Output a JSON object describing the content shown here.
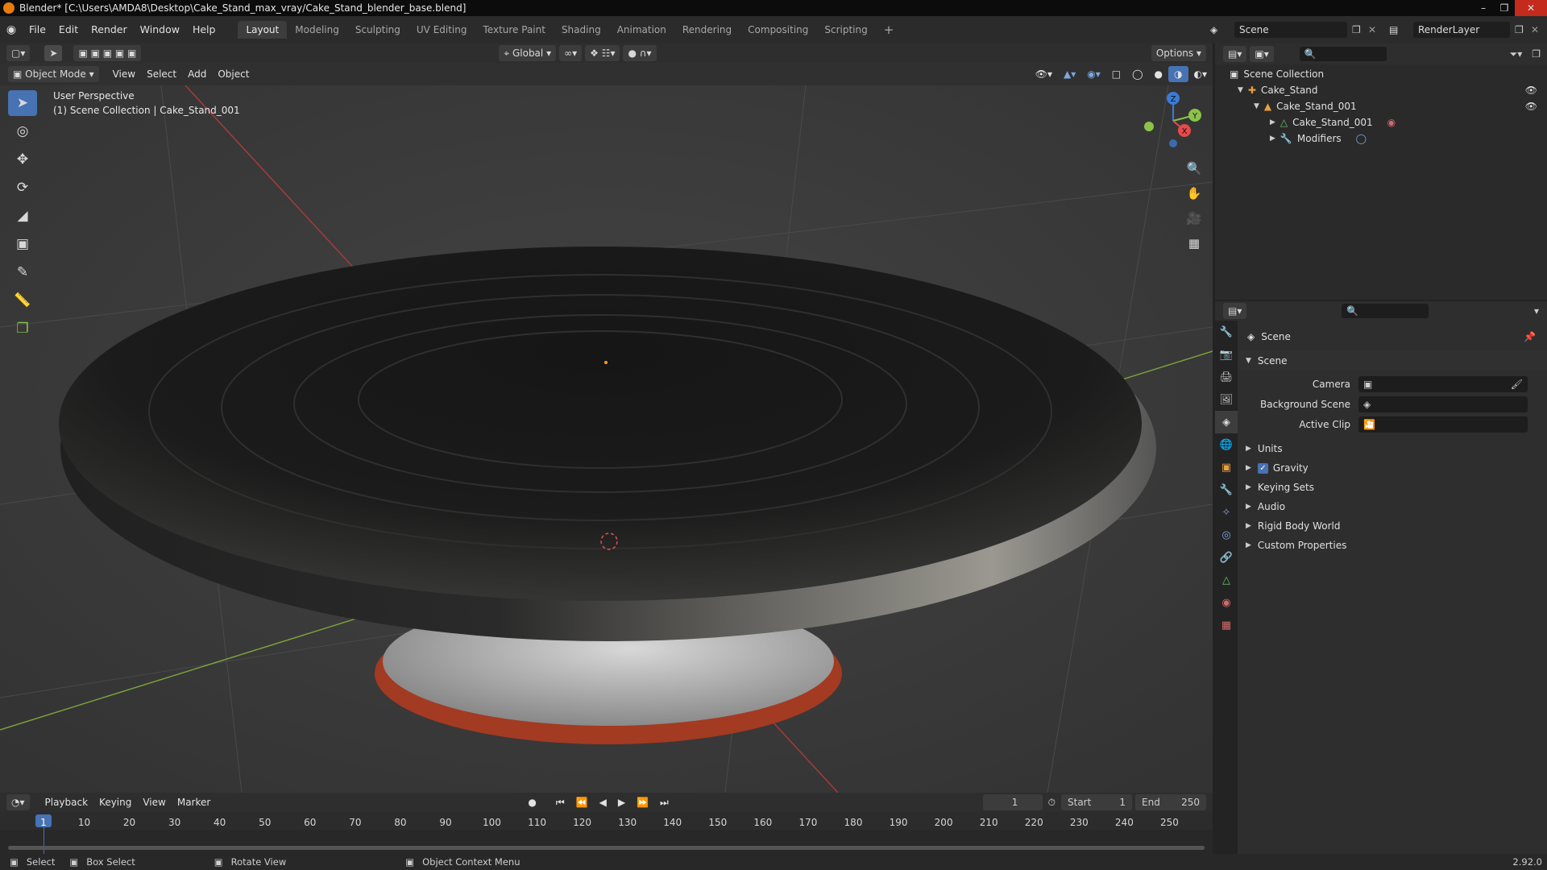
{
  "titlebar": {
    "title": "Blender* [C:\\Users\\AMDA8\\Desktop\\Cake_Stand_max_vray/Cake_Stand_blender_base.blend]"
  },
  "menubar": {
    "menus": [
      "File",
      "Edit",
      "Render",
      "Window",
      "Help"
    ],
    "workspaces": [
      "Layout",
      "Modeling",
      "Sculpting",
      "UV Editing",
      "Texture Paint",
      "Shading",
      "Animation",
      "Rendering",
      "Compositing",
      "Scripting"
    ],
    "add_tab": "+",
    "scene": "Scene",
    "view_layer": "RenderLayer"
  },
  "viewport_header": {
    "orientation": "Global",
    "options": "Options",
    "mode": "Object Mode",
    "menus": [
      "View",
      "Select",
      "Add",
      "Object"
    ]
  },
  "viewport": {
    "perspective": "User Perspective",
    "collection_info": "(1) Scene Collection | Cake_Stand_001",
    "gizmo_axes": {
      "z": "Z",
      "y": "Y",
      "x": "X"
    }
  },
  "outliner": {
    "rows": [
      {
        "label": "Scene Collection"
      },
      {
        "label": "Cake_Stand"
      },
      {
        "label": "Cake_Stand_001"
      },
      {
        "label": "Cake_Stand_001"
      },
      {
        "label": "Modifiers"
      }
    ]
  },
  "properties": {
    "context": "Scene",
    "panel": "Scene",
    "fields": [
      {
        "label": "Camera",
        "value": ""
      },
      {
        "label": "Background Scene",
        "value": ""
      },
      {
        "label": "Active Clip",
        "value": ""
      }
    ],
    "sections": [
      "Units",
      "Gravity",
      "Keying Sets",
      "Audio",
      "Rigid Body World",
      "Custom Properties"
    ],
    "gravity_checked": true
  },
  "timeline": {
    "menus": [
      "Playback",
      "Keying",
      "View",
      "Marker"
    ],
    "current_frame": "1",
    "start_label": "Start",
    "start": "1",
    "end_label": "End",
    "end": "250",
    "ticks": [
      "1",
      "10",
      "20",
      "30",
      "40",
      "50",
      "60",
      "70",
      "80",
      "90",
      "100",
      "110",
      "120",
      "130",
      "140",
      "150",
      "160",
      "170",
      "180",
      "190",
      "200",
      "210",
      "220",
      "230",
      "240",
      "250"
    ]
  },
  "statusbar": {
    "items": [
      "Select",
      "Box Select",
      "Rotate View",
      "Object Context Menu"
    ],
    "version": "2.92.0"
  },
  "colors": {
    "accent": "#4772b3",
    "brand": "#e87d0d",
    "close": "#c42b1c"
  }
}
